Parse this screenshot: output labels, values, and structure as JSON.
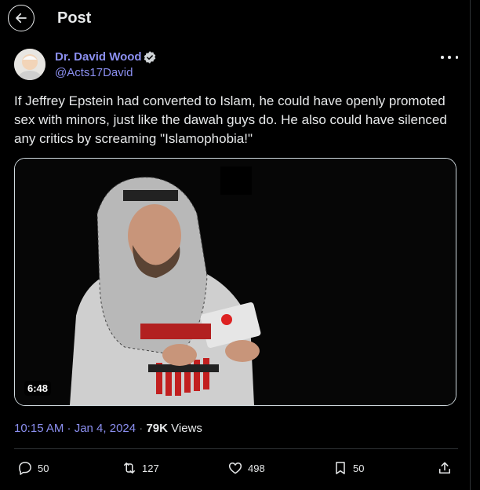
{
  "header": {
    "title": "Post"
  },
  "author": {
    "name": "Dr. David Wood",
    "handle": "@Acts17David",
    "verified": true
  },
  "post": {
    "text": "If Jeffrey Epstein had converted to Islam, he could have openly promoted sex with minors, just like the dawah guys do. He also could have silenced any critics by screaming \"Islamophobia!\"",
    "video_duration": "6:48"
  },
  "meta": {
    "time": "10:15 AM · Jan 4, 2024",
    "separator": " · ",
    "views_count": "79K",
    "views_label": "Views"
  },
  "actions": {
    "replies": "50",
    "reposts": "127",
    "likes": "498",
    "bookmarks": "50"
  },
  "colors": {
    "background": "#000000",
    "text": "#e7e9ea",
    "link": "#8b8ff0",
    "muted": "#71767b",
    "border": "#2f3336"
  }
}
